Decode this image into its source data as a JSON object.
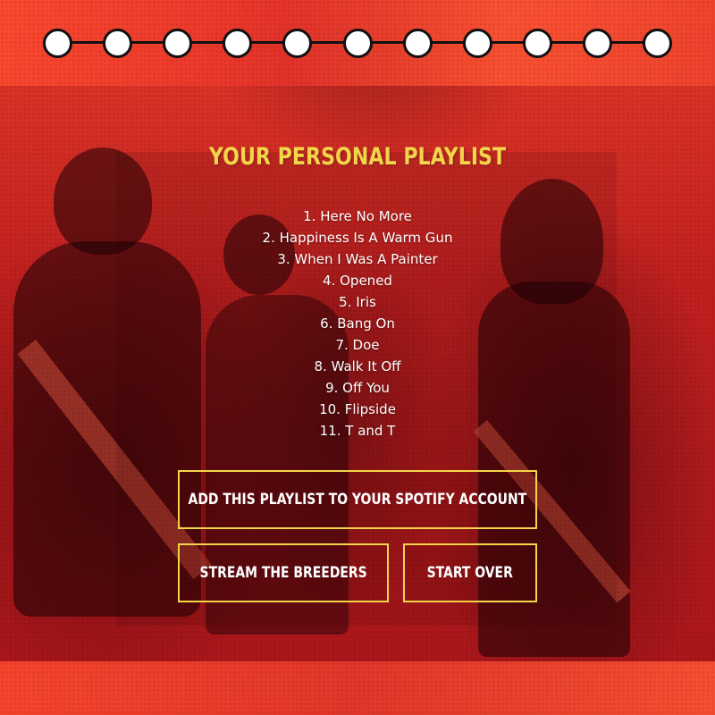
{
  "stepper": {
    "total_steps": 11,
    "completed_steps": 11
  },
  "playlist": {
    "title": "YOUR PERSONAL PLAYLIST",
    "tracks": [
      "1. Here No More",
      "2. Happiness Is A Warm Gun",
      "3. When I Was A Painter",
      "4. Opened",
      "5. Iris",
      "6. Bang On",
      "7. Doe",
      "8. Walk It Off",
      "9. Off You",
      "10. Flipside",
      "11. T and T"
    ]
  },
  "buttons": {
    "spotify_label": "ADD THIS PLAYLIST TO YOUR SPOTIFY ACCOUNT",
    "stream_label": "STREAM THE BREEDERS",
    "start_over_label": "START OVER"
  },
  "colors": {
    "accent": "#f4d44a",
    "background": "#b8171a",
    "text": "#ffffff"
  }
}
